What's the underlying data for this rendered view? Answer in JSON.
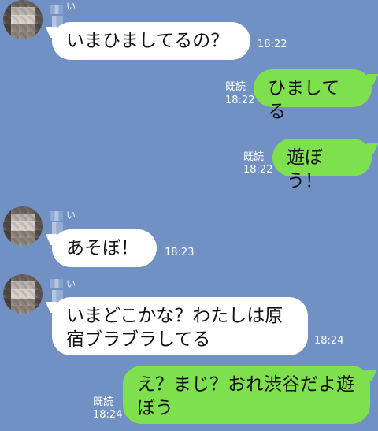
{
  "contact": {
    "name_visible": "い"
  },
  "messages": [
    {
      "side": "left",
      "text": "いまひましてるの？",
      "time": "18:22"
    },
    {
      "side": "right",
      "text": "ひましてる",
      "read": "既読",
      "time": "18:22"
    },
    {
      "side": "right",
      "text": "遊ぼう！",
      "read": "既読",
      "time": "18:22"
    },
    {
      "side": "left",
      "text": "あそぼ！",
      "time": "18:23"
    },
    {
      "side": "left",
      "text": "いまどこかな？わたしは原\n宿ブラブラしてる",
      "time": "18:24"
    },
    {
      "side": "right",
      "text": "え？まじ？おれ渋谷だよ遊\nぼう",
      "read": "既読",
      "time": "18:24"
    }
  ],
  "colors": {
    "background": "#7191c5",
    "incoming_bubble": "#ffffff",
    "outgoing_bubble": "#7ee04c",
    "meta_text": "#ffffff"
  }
}
